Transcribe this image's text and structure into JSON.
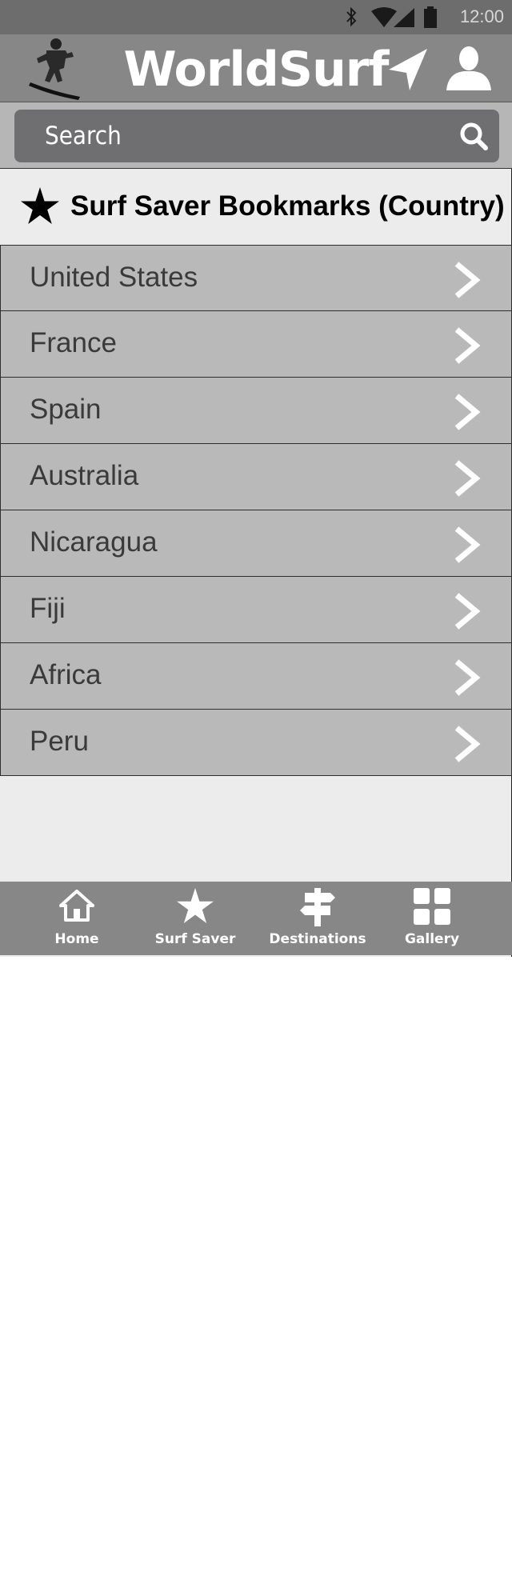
{
  "status_bar": {
    "time": "12:00",
    "icons": [
      "bluetooth-icon",
      "wifi-icon",
      "signal-icon",
      "battery-icon"
    ]
  },
  "app_bar": {
    "title": "WorldSurf",
    "icons": [
      "surfer-logo-icon",
      "navigation-arrow-icon",
      "user-icon"
    ]
  },
  "search": {
    "placeholder": "Search",
    "icon": "search-icon"
  },
  "section": {
    "icon": "star-icon",
    "title": "Surf Saver Bookmarks (Country)"
  },
  "bookmarks": [
    {
      "label": "United States"
    },
    {
      "label": "France"
    },
    {
      "label": "Spain"
    },
    {
      "label": "Australia"
    },
    {
      "label": "Nicaragua"
    },
    {
      "label": "Fiji"
    },
    {
      "label": "Africa"
    },
    {
      "label": "Peru"
    }
  ],
  "tabs": [
    {
      "label": "Home",
      "icon": "home-icon"
    },
    {
      "label": "Surf Saver",
      "icon": "star-icon"
    },
    {
      "label": "Destinations",
      "icon": "signpost-icon"
    },
    {
      "label": "Gallery",
      "icon": "grid-icon"
    }
  ],
  "colors": {
    "app_bar": "#878787",
    "status_bar": "#6d6d6d",
    "list_row": "#b9b9b9",
    "search_box": "#6f6f72",
    "background": "#ececec"
  }
}
